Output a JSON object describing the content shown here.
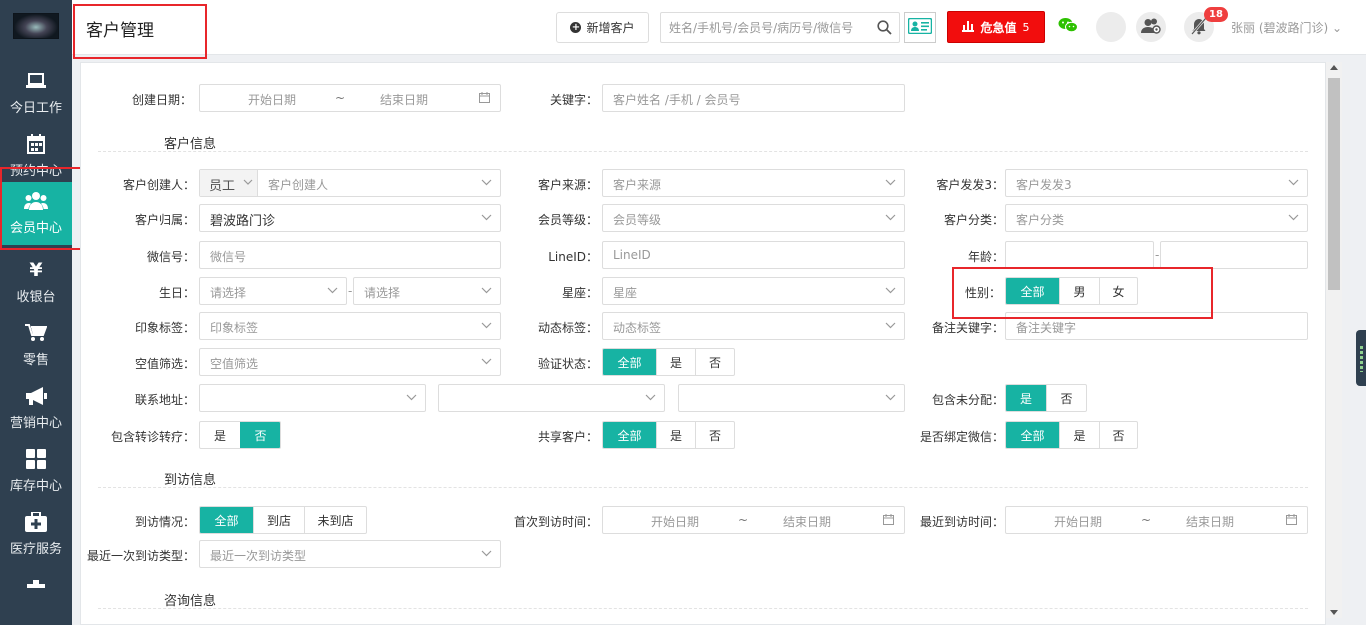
{
  "header": {
    "title": "客户管理",
    "new_customer_label": "新增客户",
    "search_placeholder": "姓名/手机号/会员号/病历号/微信号",
    "danger_label": "危急值",
    "danger_count": "5",
    "notification_count": "18",
    "user_name": "张丽 (碧波路门诊)"
  },
  "sidebar": {
    "items": [
      {
        "label": "今日工作",
        "icon": "laptop-icon"
      },
      {
        "label": "预约中心",
        "icon": "calendar-icon"
      },
      {
        "label": "会员中心",
        "icon": "users-icon",
        "active": true
      },
      {
        "label": "收银台",
        "icon": "yen-icon"
      },
      {
        "label": "零售",
        "icon": "cart-icon"
      },
      {
        "label": "营销中心",
        "icon": "megaphone-icon"
      },
      {
        "label": "库存中心",
        "icon": "grid-icon"
      },
      {
        "label": "医疗服务",
        "icon": "medkit-icon"
      }
    ]
  },
  "filters": {
    "create_date": {
      "label": "创建日期：",
      "start_placeholder": "开始日期",
      "end_placeholder": "结束日期",
      "separator": "~"
    },
    "keyword": {
      "label": "关键字：",
      "placeholder": "客户姓名 /手机 / 会员号"
    },
    "section_customer": "客户信息",
    "creator": {
      "label": "客户创建人：",
      "type_value": "员工",
      "placeholder": "客户创建人"
    },
    "source": {
      "label": "客户来源：",
      "placeholder": "客户来源"
    },
    "fafa3": {
      "label": "客户发发3：",
      "placeholder": "客户发发3"
    },
    "belong": {
      "label": "客户归属：",
      "value": "碧波路门诊"
    },
    "member_level": {
      "label": "会员等级：",
      "placeholder": "会员等级"
    },
    "category": {
      "label": "客户分类：",
      "placeholder": "客户分类"
    },
    "wechat": {
      "label": "微信号：",
      "placeholder": "微信号"
    },
    "lineid": {
      "label": "LineID：",
      "placeholder": "LineID"
    },
    "age": {
      "label": "年龄：",
      "separator": "-"
    },
    "birthday": {
      "label": "生日：",
      "placeholder_from": "请选择",
      "placeholder_to": "请选择",
      "separator": "-"
    },
    "zodiac": {
      "label": "星座：",
      "placeholder": "星座"
    },
    "gender": {
      "label": "性别：",
      "options": [
        "全部",
        "男",
        "女"
      ]
    },
    "impression_tag": {
      "label": "印象标签：",
      "placeholder": "印象标签"
    },
    "dynamic_tag": {
      "label": "动态标签：",
      "placeholder": "动态标签"
    },
    "remark_keyword": {
      "label": "备注关键字：",
      "placeholder": "备注关键字"
    },
    "empty_value": {
      "label": "空值筛选：",
      "placeholder": "空值筛选"
    },
    "verify_status": {
      "label": "验证状态：",
      "options": [
        "全部",
        "是",
        "否"
      ]
    },
    "address": {
      "label": "联系地址："
    },
    "include_unassigned": {
      "label": "包含未分配：",
      "options": [
        "是",
        "否"
      ]
    },
    "include_transfer": {
      "label": "包含转诊转疗：",
      "options": [
        "是",
        "否"
      ]
    },
    "shared_customer": {
      "label": "共享客户：",
      "options": [
        "全部",
        "是",
        "否"
      ]
    },
    "bind_wechat": {
      "label": "是否绑定微信：",
      "options": [
        "全部",
        "是",
        "否"
      ]
    },
    "section_visit": "到访信息",
    "visit_status": {
      "label": "到访情况：",
      "options": [
        "全部",
        "到店",
        "未到店"
      ]
    },
    "first_visit": {
      "label": "首次到访时间：",
      "start_placeholder": "开始日期",
      "end_placeholder": "结束日期",
      "separator": "~"
    },
    "last_visit": {
      "label": "最近到访时间：",
      "start_placeholder": "开始日期",
      "end_placeholder": "结束日期",
      "separator": "~"
    },
    "last_visit_type": {
      "label": "最近一次到访类型：",
      "placeholder": "最近一次到访类型"
    },
    "section_consult": "咨询信息"
  },
  "colors": {
    "accent": "#17b3a3",
    "sidebar": "#2f4050",
    "danger": "#f20d0d",
    "highlight": "#e8262b"
  }
}
